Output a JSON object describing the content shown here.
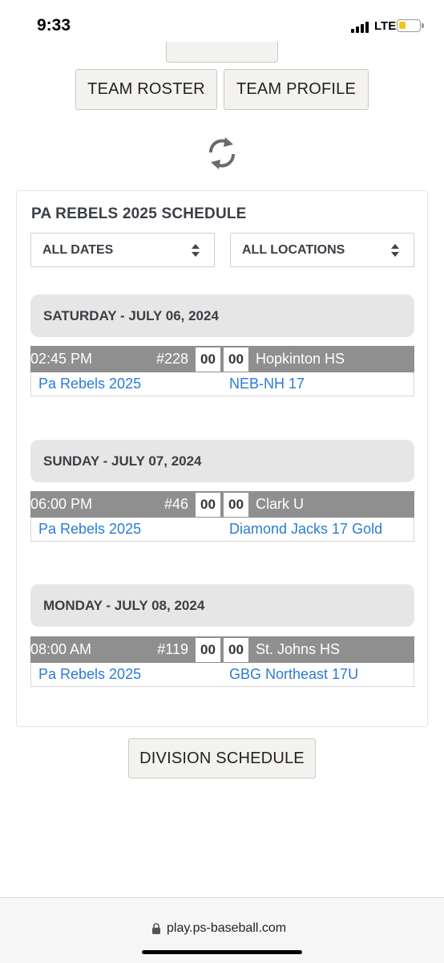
{
  "status_bar": {
    "time": "9:33",
    "network": "LTE",
    "battery_level": 0.35
  },
  "nav": {
    "team_roster_label": "TEAM ROSTER",
    "team_profile_label": "TEAM PROFILE"
  },
  "schedule": {
    "title": "PA REBELS 2025 SCHEDULE",
    "date_filter": "ALL DATES",
    "location_filter": "ALL LOCATIONS",
    "days": [
      {
        "header": "SATURDAY - JULY 06, 2024",
        "game": {
          "time": "02:45 PM",
          "number": "#228",
          "score_home": "00",
          "score_away": "00",
          "location": "Hopkinton HS",
          "home_team": "Pa Rebels 2025",
          "away_team": "NEB-NH 17"
        }
      },
      {
        "header": "SUNDAY - JULY 07, 2024",
        "game": {
          "time": "06:00 PM",
          "number": "#46",
          "score_home": "00",
          "score_away": "00",
          "location": "Clark U",
          "home_team": "Pa Rebels 2025",
          "away_team": "Diamond Jacks 17 Gold"
        }
      },
      {
        "header": "MONDAY - JULY 08, 2024",
        "game": {
          "time": "08:00 AM",
          "number": "#119",
          "score_home": "00",
          "score_away": "00",
          "location": "St. Johns HS",
          "home_team": "Pa Rebels 2025",
          "away_team": "GBG Northeast 17U"
        }
      }
    ]
  },
  "division_schedule_label": "DIVISION SCHEDULE",
  "browser": {
    "url": "play.ps-baseball.com"
  },
  "icons": {
    "refresh": "refresh-icon",
    "lock": "lock-icon",
    "select_arrows": "sort-arrows-icon"
  },
  "colors": {
    "link": "#2a7bd6",
    "game_bar": "#8f8f8f",
    "day_header_bg": "#e6e6e6"
  }
}
